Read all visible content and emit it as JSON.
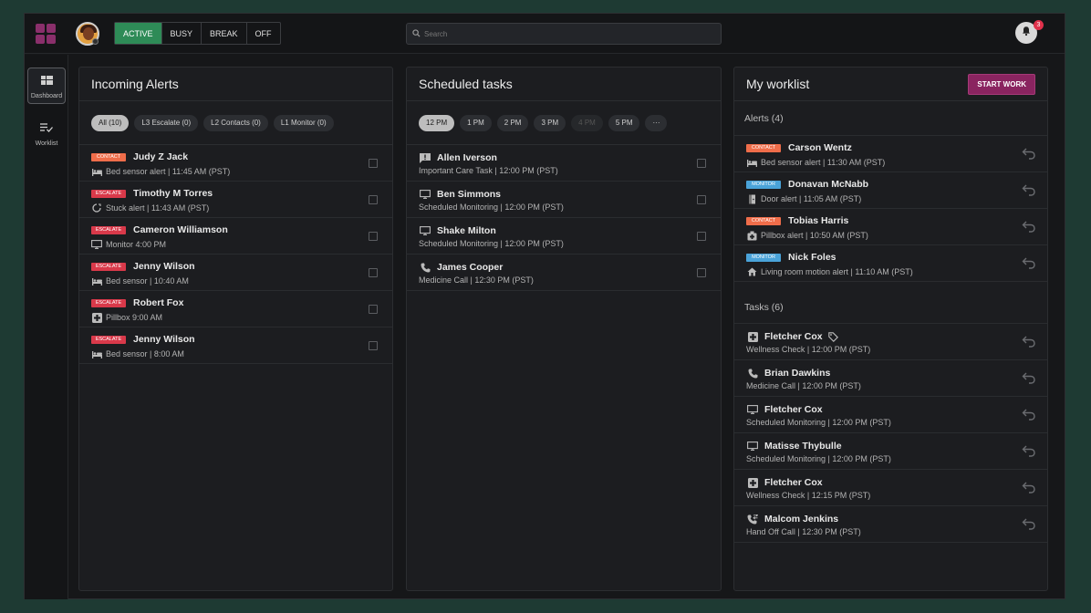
{
  "topbar": {
    "statuses": [
      "ACTIVE",
      "BUSY",
      "BREAK",
      "OFF"
    ],
    "active_status": "ACTIVE",
    "search_placeholder": "Search",
    "notification_count": "3"
  },
  "sidebar": {
    "items": [
      {
        "label": "Dashboard",
        "icon": "dashboard-icon",
        "selected": true
      },
      {
        "label": "Worklist",
        "icon": "worklist-icon",
        "selected": false
      }
    ]
  },
  "incoming": {
    "title": "Incoming Alerts",
    "filters": [
      "All (10)",
      "L3 Escalate (0)",
      "L2 Contacts (0)",
      "L1 Monitor (0)"
    ],
    "rows": [
      {
        "tag": "CONTACT",
        "tag_type": "contact",
        "name": "Judy Z Jack",
        "icon": "bed-icon",
        "detail": "Bed sensor alert | 11:45 AM (PST)"
      },
      {
        "tag": "ESCALATE",
        "tag_type": "escalate",
        "name": "Timothy M Torres",
        "icon": "spinner-icon",
        "detail": "Stuck alert | 11:43 AM (PST)"
      },
      {
        "tag": "ESCALATE",
        "tag_type": "escalate",
        "name": "Cameron Williamson",
        "icon": "monitor-icon",
        "detail": "Monitor  4:00 PM"
      },
      {
        "tag": "ESCALATE",
        "tag_type": "escalate",
        "name": "Jenny Wilson",
        "icon": "bed-icon",
        "detail": "Bed sensor | 10:40 AM"
      },
      {
        "tag": "ESCALATE",
        "tag_type": "escalate",
        "name": "Robert Fox",
        "icon": "medical-plus-icon",
        "detail": "Pillbox  9:00 AM"
      },
      {
        "tag": "ESCALATE",
        "tag_type": "escalate",
        "name": "Jenny Wilson",
        "icon": "bed-icon",
        "detail": "Bed sensor | 8:00 AM"
      }
    ]
  },
  "scheduled": {
    "title": "Scheduled tasks",
    "times": [
      "12 PM",
      "1 PM",
      "2 PM",
      "3 PM",
      "4 PM",
      "5 PM",
      "···"
    ],
    "rows": [
      {
        "icon": "alert-message-icon",
        "name": "Allen Iverson",
        "detail": "Important Care Task | 12:00 PM (PST)"
      },
      {
        "icon": "monitor-icon",
        "name": "Ben Simmons",
        "detail": "Scheduled Monitoring | 12:00 PM (PST)"
      },
      {
        "icon": "monitor-icon",
        "name": "Shake Milton",
        "detail": "Scheduled Monitoring | 12:00 PM (PST)"
      },
      {
        "icon": "phone-icon",
        "name": "James Cooper",
        "detail": "Medicine Call | 12:30 PM (PST)"
      }
    ]
  },
  "worklist": {
    "title": "My worklist",
    "start_label": "START WORK",
    "alerts_label": "Alerts (4)",
    "alerts": [
      {
        "tag": "CONTACT",
        "tag_type": "contact",
        "name": "Carson Wentz",
        "icon": "bed-icon",
        "detail": "Bed sensor alert |  11:30 AM (PST)"
      },
      {
        "tag": "MONITOR",
        "tag_type": "monitor",
        "name": "Donavan McNabb",
        "icon": "door-icon",
        "detail": "Door alert |  11:05 AM (PST)"
      },
      {
        "tag": "CONTACT",
        "tag_type": "contact",
        "name": "Tobias Harris",
        "icon": "pillbox-icon",
        "detail": "Pillbox alert |  10:50 AM (PST)"
      },
      {
        "tag": "MONITOR",
        "tag_type": "monitor",
        "name": "Nick Foles",
        "icon": "home-icon",
        "detail": "Living room motion alert |  11:10 AM (PST)"
      }
    ],
    "tasks_label": "Tasks (6)",
    "tasks": [
      {
        "icon": "medical-plus-icon",
        "name": "Fletcher Cox",
        "detail": "Wellness Check | 12:00 PM (PST)",
        "tagged": true
      },
      {
        "icon": "phone-icon",
        "name": "Brian Dawkins",
        "detail": "Medicine Call | 12:00 PM (PST)",
        "tagged": false
      },
      {
        "icon": "monitor-icon",
        "name": "Fletcher Cox",
        "detail": "Scheduled Monitoring | 12:00 PM (PST)",
        "tagged": false
      },
      {
        "icon": "monitor-icon",
        "name": "Matisse Thybulle",
        "detail": "Scheduled Monitoring | 12:00 PM (PST)",
        "tagged": false
      },
      {
        "icon": "medical-plus-icon",
        "name": "Fletcher Cox",
        "detail": "Wellness Check | 12:15 PM (PST)",
        "tagged": false
      },
      {
        "icon": "phone-transfer-icon",
        "name": "Malcom Jenkins",
        "detail": "Hand Off Call | 12:30 PM (PST)",
        "tagged": false
      }
    ]
  },
  "colors": {
    "active": "#2e8b57",
    "contact": "#ef6d4a",
    "escalate": "#d9394a",
    "monitor": "#4aa3d9",
    "start_work": "#8a2460"
  }
}
